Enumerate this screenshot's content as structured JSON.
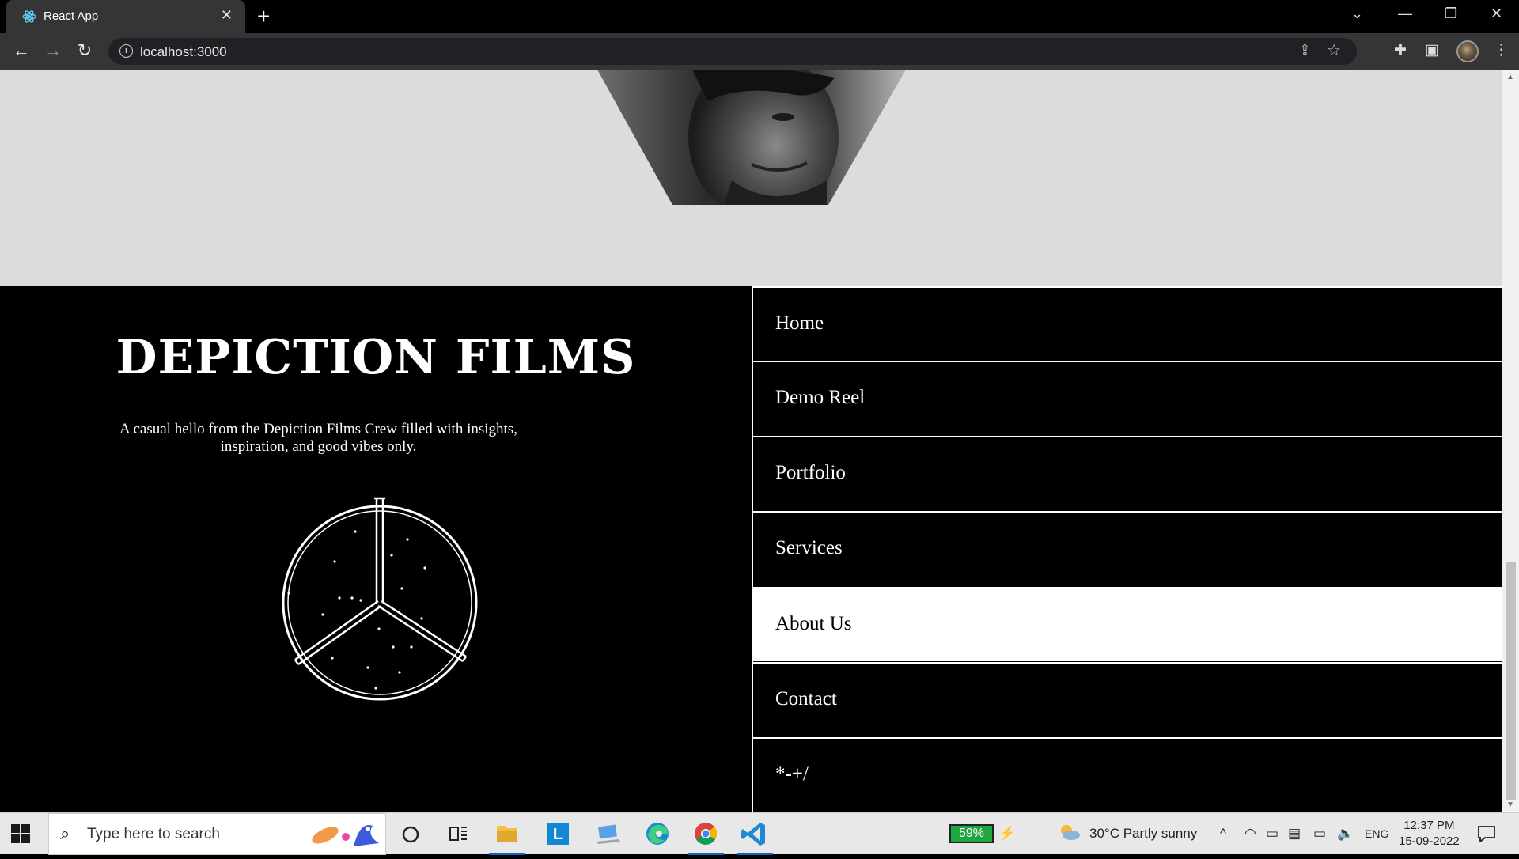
{
  "browser": {
    "tab_title": "React App",
    "tab_close": "✕",
    "new_tab": "+",
    "url": "localhost:3000"
  },
  "page": {
    "brand_title": "DEPICTION FILMS",
    "tagline": "A casual hello from the Depiction Films Crew filled with insights, inspiration, and good vibes only.",
    "menu": [
      {
        "label": "Home",
        "active": false
      },
      {
        "label": "Demo Reel",
        "active": false
      },
      {
        "label": "Portfolio",
        "active": false
      },
      {
        "label": "Services",
        "active": false
      },
      {
        "label": "About Us",
        "active": true
      },
      {
        "label": "Contact",
        "active": false
      },
      {
        "label": "*-+/",
        "active": false
      }
    ]
  },
  "taskbar": {
    "search_placeholder": "Type here to search",
    "battery": "59%",
    "weather": "30°C  Partly sunny",
    "language": "ENG",
    "time": "12:37 PM",
    "date": "15-09-2022"
  },
  "icons": [
    "react-icon",
    "back-icon",
    "forward-icon",
    "reload-icon",
    "info-icon",
    "share-icon",
    "star-icon",
    "extensions-icon",
    "sidepanel-icon",
    "menu-icon",
    "windows-icon",
    "search-icon",
    "cortana-icon",
    "taskview-icon",
    "explorer-icon",
    "chrome-icon",
    "edge-icon",
    "vscode-icon"
  ],
  "colors": {
    "menu_active_bg": "#ffffff",
    "hero_bg": "#dcdcdc",
    "page_bg": "#000000"
  }
}
